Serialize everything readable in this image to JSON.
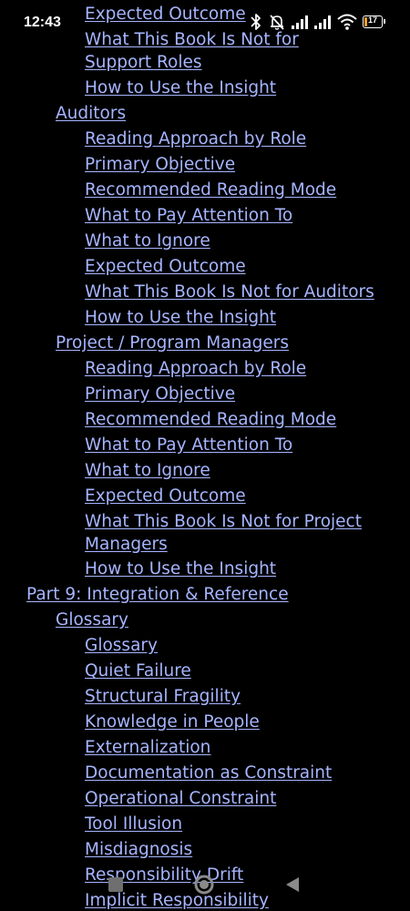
{
  "status_bar": {
    "time": "12:43",
    "battery_level": "17",
    "battery_fraction": 0.17,
    "battery_color": "#f0a020",
    "icons": [
      "bluetooth-icon",
      "mute-icon",
      "signal-icon",
      "signal-icon",
      "wifi-icon",
      "battery-icon"
    ]
  },
  "toc": {
    "link_color": "#a6b5ff",
    "items": [
      {
        "text": "Expected Outcome",
        "level": 2
      },
      {
        "text": "What This Book Is Not for Support Roles",
        "level": 2
      },
      {
        "text": "How to Use the Insight",
        "level": 2
      },
      {
        "text": "Auditors",
        "level": 1
      },
      {
        "text": "Reading Approach by Role",
        "level": 2
      },
      {
        "text": "Primary Objective",
        "level": 2
      },
      {
        "text": "Recommended Reading Mode",
        "level": 2
      },
      {
        "text": "What to Pay Attention To",
        "level": 2
      },
      {
        "text": "What to Ignore",
        "level": 2
      },
      {
        "text": "Expected Outcome",
        "level": 2
      },
      {
        "text": "What This Book Is Not for Auditors",
        "level": 2
      },
      {
        "text": "How to Use the Insight",
        "level": 2
      },
      {
        "text": "Project / Program Managers",
        "level": 1
      },
      {
        "text": "Reading Approach by Role",
        "level": 2
      },
      {
        "text": "Primary Objective",
        "level": 2
      },
      {
        "text": "Recommended Reading Mode",
        "level": 2
      },
      {
        "text": "What to Pay Attention To",
        "level": 2
      },
      {
        "text": "What to Ignore",
        "level": 2
      },
      {
        "text": "Expected Outcome",
        "level": 2
      },
      {
        "text": "What This Book Is Not for Project Managers",
        "level": 2
      },
      {
        "text": "How to Use the Insight",
        "level": 2
      },
      {
        "text": "Part 9: Integration & Reference",
        "level": 0
      },
      {
        "text": "Glossary",
        "level": 1
      },
      {
        "text": "Glossary",
        "level": 2
      },
      {
        "text": "Quiet Failure",
        "level": 2
      },
      {
        "text": "Structural Fragility",
        "level": 2
      },
      {
        "text": "Knowledge in People",
        "level": 2
      },
      {
        "text": "Externalization",
        "level": 2
      },
      {
        "text": "Documentation as Constraint",
        "level": 2
      },
      {
        "text": "Operational Constraint",
        "level": 2
      },
      {
        "text": "Tool Illusion",
        "level": 2
      },
      {
        "text": "Misdiagnosis",
        "level": 2
      },
      {
        "text": "Responsibility Drift",
        "level": 2
      },
      {
        "text": "Implicit Responsibility",
        "level": 2
      }
    ]
  },
  "nav_bar": {
    "buttons": [
      "recents-button",
      "home-button",
      "back-button"
    ]
  }
}
